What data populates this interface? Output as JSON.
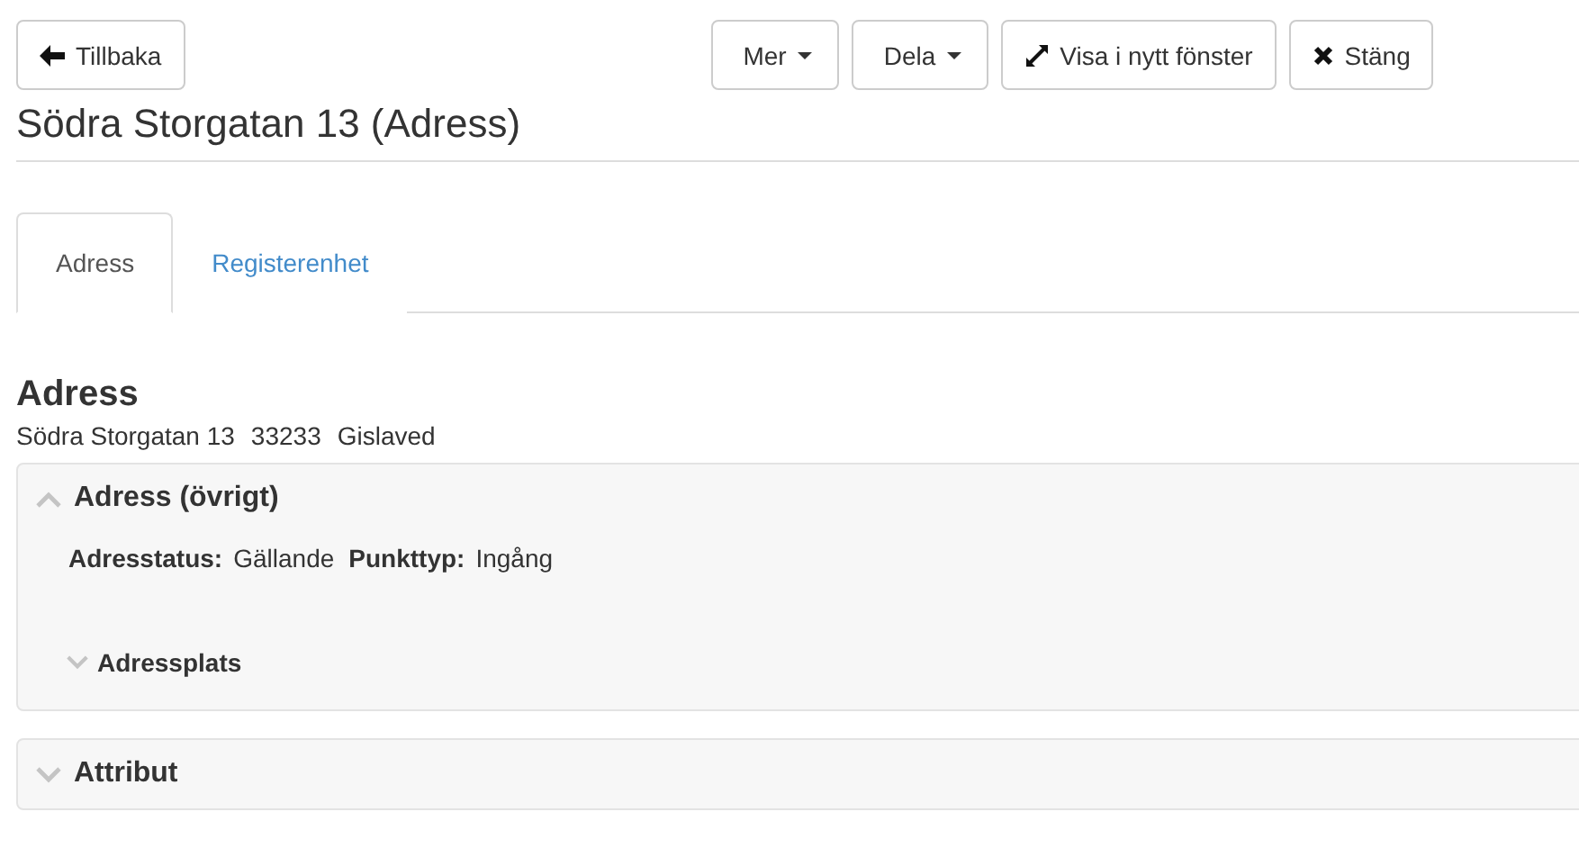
{
  "toolbar": {
    "back_button": {
      "label": "Tillbaka"
    },
    "buttons": [
      {
        "label": "Mer",
        "kind": "dropdown"
      },
      {
        "label": "Dela",
        "kind": "dropdown"
      },
      {
        "label": "Visa i nytt fönster",
        "kind": "expand"
      },
      {
        "label": "Stäng",
        "kind": "close"
      }
    ]
  },
  "title": "Södra Storgatan 13 (Adress)",
  "tabs": [
    {
      "label": "Adress",
      "selected": true
    },
    {
      "label": "Registerenhet",
      "selected": false
    }
  ],
  "heading": "Adress",
  "address_line": [
    "Södra Storgatan 13",
    "33233",
    "Gislaved"
  ],
  "panels": [
    {
      "title": "Adress (övrigt)",
      "expanded": true,
      "fields": [
        {
          "label": "Adresstatus:",
          "value": "Gällande"
        },
        {
          "label": "Punkttyp:",
          "value": "Ingång"
        }
      ],
      "subsections": [
        {
          "title": "Adressplats",
          "expanded": false
        }
      ]
    },
    {
      "title": "Attribut",
      "expanded": false
    }
  ]
}
